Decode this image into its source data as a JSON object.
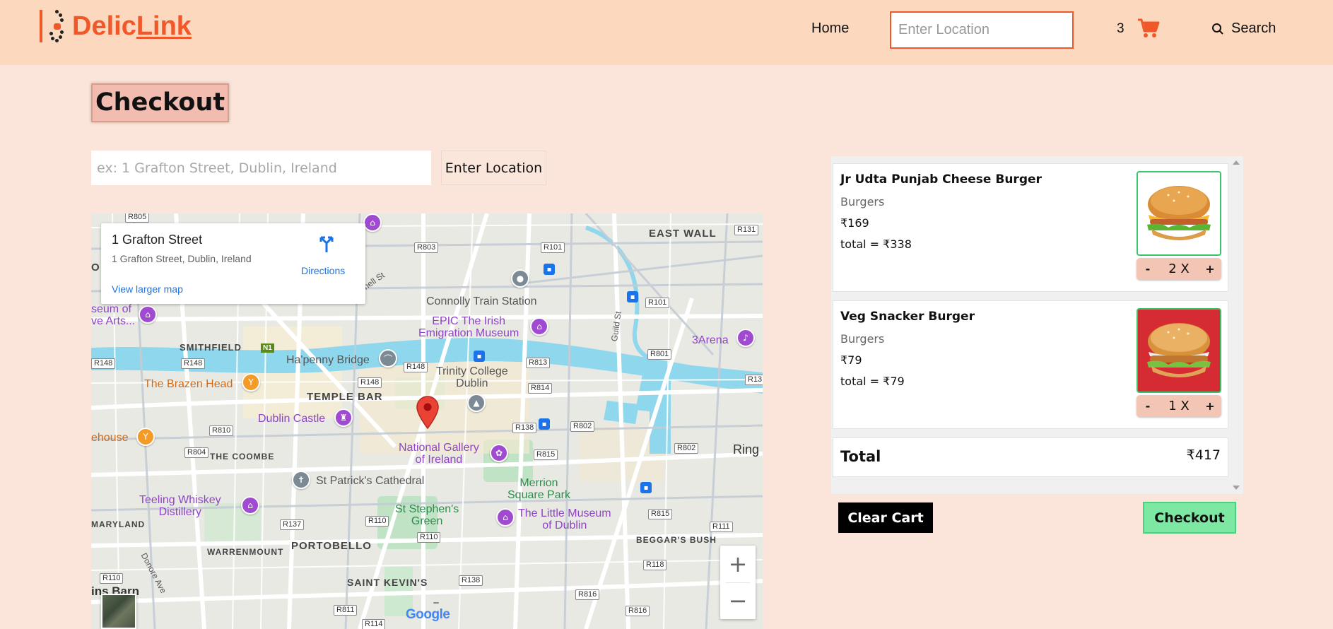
{
  "app": {
    "brand_prefix": "Delic",
    "brand_suffix": "Link",
    "brand_color": "#f0582a"
  },
  "nav": {
    "home": "Home",
    "location_placeholder": "Enter Location",
    "cart_count": "3",
    "cart_icon": "cart-icon",
    "search_icon": "search-icon",
    "search": "Search"
  },
  "page": {
    "title": "Checkout",
    "address_placeholder": "ex: 1 Grafton Street, Dublin, Ireland",
    "address_button": "Enter Location"
  },
  "map": {
    "place_name": "1 Grafton Street",
    "place_address": "1 Grafton Street, Dublin, Ireland",
    "directions": "Directions",
    "view_larger": "View larger map",
    "zoom_in": "+",
    "zoom_out": "−",
    "areas": [
      "EAST WALL",
      "SMITHFIELD",
      "TEMPLE BAR",
      "THE COOMBE",
      "PORTOBELLO",
      "WARRENMOUNT",
      "SAINT KEVIN'S",
      "BEGGAR'S BUSH",
      "MARYLAND"
    ],
    "pois": {
      "connolly": "Connolly Train Station",
      "epic_1": "EPIC The Irish",
      "epic_2": "Emigration Museum",
      "arena": "3Arena",
      "hapenny": "Ha'penny Bridge",
      "trinity_1": "Trinity College",
      "trinity_2": "Dublin",
      "brazen": "The Brazen Head",
      "castle": "Dublin Castle",
      "gallery_1": "National Gallery",
      "gallery_2": "of Ireland",
      "ring": "Ring",
      "ehouse": "ehouse",
      "museum_1": "seum of",
      "museum_2": "ve Arts...",
      "stpatrick": "St Patrick's Cathedral",
      "merrion_1": "Merrion",
      "merrion_2": "Square Park",
      "teeling_1": "Teeling Whiskey",
      "teeling_2": "Distillery",
      "stephens_1": "St Stephen's",
      "stephens_2": "Green",
      "little_1": "The Little Museum",
      "little_2": "of Dublin",
      "donore": "Donore Ave",
      "guild": "Guild St",
      "parnell": "Parnell St",
      "inns": "ins Barn",
      "left_o": "O",
      "n1": "N1"
    },
    "roads": [
      "R805",
      "R803",
      "R101",
      "R131",
      "R101",
      "R148",
      "R148",
      "R148",
      "R148",
      "R813",
      "R801",
      "R13",
      "R814",
      "R810",
      "R138",
      "R802",
      "R804",
      "R815",
      "R802",
      "R137",
      "R110",
      "R815",
      "R111",
      "R110",
      "R138",
      "R118",
      "R110",
      "R811",
      "R816",
      "R816",
      "R114"
    ],
    "google": "Google"
  },
  "cart": {
    "items": [
      {
        "name": "Jr Udta Punjab Cheese Burger",
        "category": "Burgers",
        "price": "₹169",
        "total": "total = ₹338",
        "qty": "2 X",
        "minus": "-",
        "plus": "+",
        "image": "burger-image"
      },
      {
        "name": "Veg Snacker Burger",
        "category": "Burgers",
        "price": "₹79",
        "total": "total = ₹79",
        "qty": "1 X",
        "minus": "-",
        "plus": "+",
        "image": "burger-image"
      }
    ],
    "total_label": "Total",
    "total_value": "₹417",
    "clear_button": "Clear Cart",
    "checkout_button": "Checkout"
  }
}
